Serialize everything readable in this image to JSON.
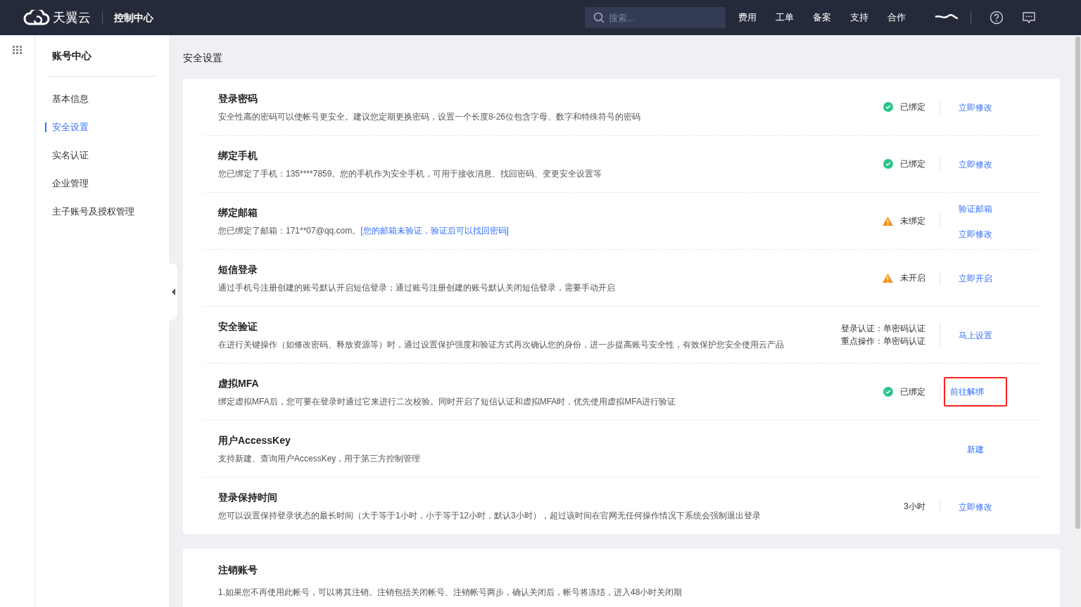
{
  "header": {
    "brand": "天翼云",
    "console": "控制中心",
    "search": {
      "placeholder": "搜索..."
    },
    "nav": [
      "费用",
      "工单",
      "备案",
      "支持",
      "合作"
    ]
  },
  "sidebar": {
    "title": "账号中心",
    "items": [
      {
        "label": "基本信息",
        "selected": false
      },
      {
        "label": "安全设置",
        "selected": true
      },
      {
        "label": "实名认证",
        "selected": false
      },
      {
        "label": "企业管理",
        "selected": false
      },
      {
        "label": "主子账号及授权管理",
        "selected": false
      }
    ]
  },
  "page_title": "安全设置",
  "settings": [
    {
      "title": "登录密码",
      "description": "安全性高的密码可以使帐号更安全。建议您定期更换密码，设置一个长度8-26位包含字母、数字和特殊符号的密码",
      "status": {
        "kind": "ok",
        "lines": [
          "已绑定"
        ]
      },
      "actions": [
        {
          "label": "立即修改",
          "highlighted": false
        }
      ]
    },
    {
      "title": "绑定手机",
      "description": "您已绑定了手机：135****7859。您的手机作为安全手机，可用于接收消息、找回密码、变更安全设置等",
      "status": {
        "kind": "ok",
        "lines": [
          "已绑定"
        ]
      },
      "actions": [
        {
          "label": "立即修改",
          "highlighted": false
        }
      ]
    },
    {
      "title": "绑定邮箱",
      "description": "您已绑定了邮箱：171**07@qq.com。",
      "note": "[您的邮箱未验证，验证后可以找回密码]",
      "status": {
        "kind": "warn",
        "lines": [
          "未绑定"
        ]
      },
      "actions": [
        {
          "label": "验证邮箱",
          "highlighted": false
        },
        {
          "label": "立即修改",
          "highlighted": false
        }
      ]
    },
    {
      "title": "短信登录",
      "description": "通过手机号注册创建的账号默认开启短信登录；通过账号注册创建的账号默认关闭短信登录，需要手动开启",
      "status": {
        "kind": "warn",
        "lines": [
          "未开启"
        ]
      },
      "actions": [
        {
          "label": "立即开启",
          "highlighted": false
        }
      ]
    },
    {
      "title": "安全验证",
      "description": "在进行关键操作（如修改密码、释放资源等）时，通过设置保护强度和验证方式再次确认您的身份，进一步提高账号安全性，有效保护您安全使用云产品",
      "status": {
        "kind": "plain",
        "lines": [
          "登录认证：单密码认证",
          "重点操作：单密码认证"
        ]
      },
      "actions": [
        {
          "label": "马上设置",
          "highlighted": false
        }
      ]
    },
    {
      "title": "虚拟MFA",
      "description": "绑定虚拟MFA后，您可要在登录时通过它来进行二次校验。同时开启了短信认证和虚拟MFA时，优先使用虚拟MFA进行验证",
      "status": {
        "kind": "ok",
        "lines": [
          "已绑定"
        ]
      },
      "actions": [
        {
          "label": "前往解绑",
          "highlighted": true
        }
      ]
    },
    {
      "title": "用户AccessKey",
      "description": "支持新建、查询用户AccessKey，用于第三方控制管理",
      "actions": [
        {
          "label": "新建",
          "highlighted": false
        }
      ]
    },
    {
      "title": "登录保持时间",
      "description": "您可以设置保持登录状态的最长时间（大于等于1小时，小于等于12小时，默认3小时），超过该时间在官网无任何操作情况下系统会强制退出登录",
      "status": {
        "kind": "plain",
        "lines": [
          "3小时"
        ]
      },
      "actions": [
        {
          "label": "立即修改",
          "highlighted": false
        }
      ]
    }
  ],
  "close_account": {
    "title": "注销账号",
    "description": "1.如果您不再使用此帐号，可以将其注销。注销包括关闭帐号、注销帐号两步，确认关闭后，帐号将冻结，进入48小时关闭期"
  }
}
